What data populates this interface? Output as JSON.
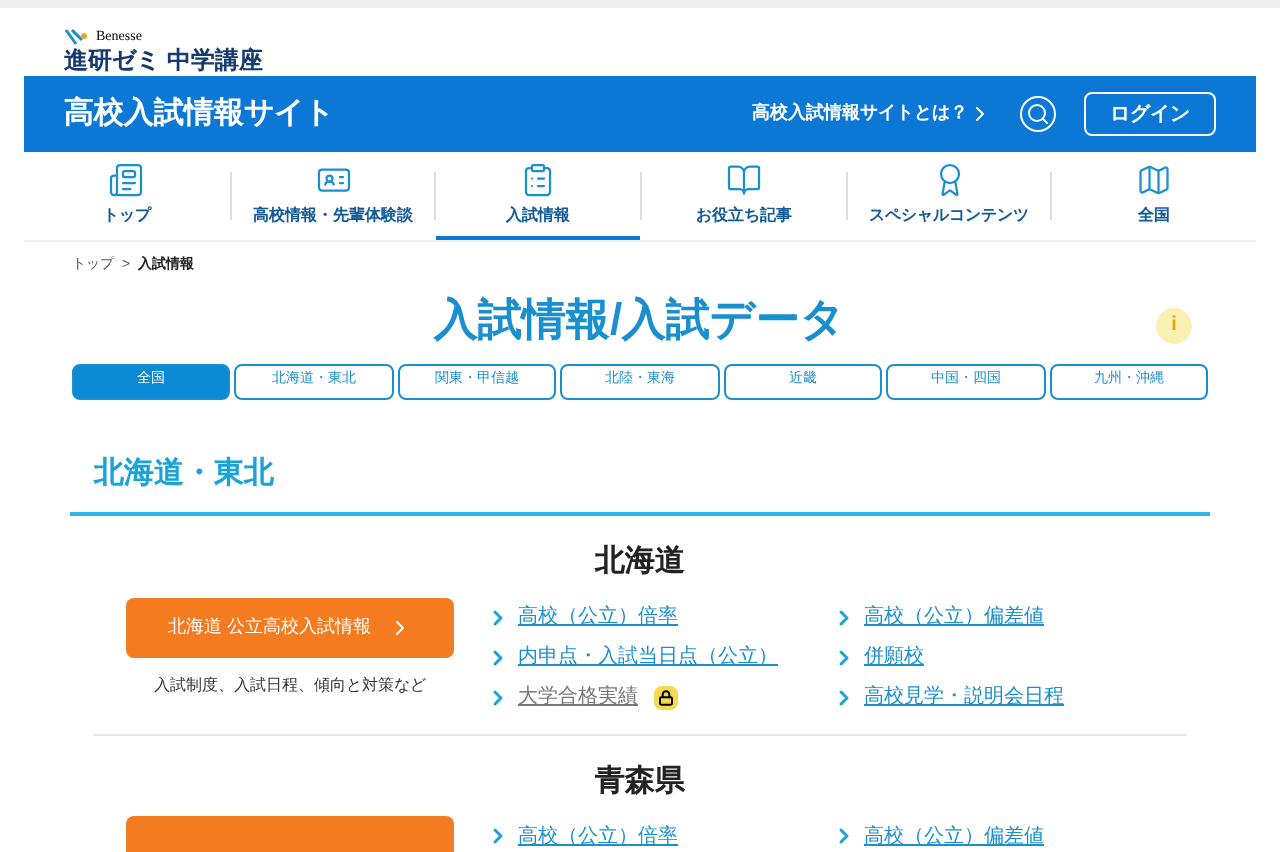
{
  "brand": {
    "company": "Benesse",
    "product": "進研ゼミ 中学講座"
  },
  "site_bar": {
    "title": "高校入試情報サイト",
    "about_link": "高校入試情報サイトとは？",
    "login": "ログイン"
  },
  "nav": [
    {
      "label": "トップ",
      "selected": false
    },
    {
      "label": "高校情報・先輩体験談",
      "selected": false
    },
    {
      "label": "入試情報",
      "selected": true
    },
    {
      "label": "お役立ち記事",
      "selected": false
    },
    {
      "label": "スペシャルコンテンツ",
      "selected": false
    },
    {
      "label": "全国",
      "selected": false
    }
  ],
  "breadcrumb": [
    {
      "label": "トップ",
      "current": false
    },
    {
      "label": "入試情報",
      "current": true
    }
  ],
  "breadcrumb_separator": ">",
  "page_title": "入試情報/入試データ",
  "info_badge": "i",
  "region_tabs": [
    {
      "label": "全国",
      "selected": true
    },
    {
      "label": "北海道・東北",
      "selected": false
    },
    {
      "label": "関東・甲信越",
      "selected": false
    },
    {
      "label": "北陸・東海",
      "selected": false
    },
    {
      "label": "近畿",
      "selected": false
    },
    {
      "label": "中国・四国",
      "selected": false
    },
    {
      "label": "九州・沖縄",
      "selected": false
    }
  ],
  "section_heading": "北海道・東北",
  "prefectures": [
    {
      "name": "北海道",
      "button": "北海道 公立高校入試情報",
      "description": "入試制度、入試日程、傾向と対策など",
      "links": [
        {
          "label": "高校（公立）倍率",
          "locked": false
        },
        {
          "label": "高校（公立）偏差値",
          "locked": false
        },
        {
          "label": "内申点・入試当日点（公立）",
          "locked": false
        },
        {
          "label": "併願校",
          "locked": false
        },
        {
          "label": "大学合格実績",
          "locked": true
        },
        {
          "label": "高校見学・説明会日程",
          "locked": false
        }
      ]
    },
    {
      "name": "青森県",
      "links": [
        {
          "label": "高校（公立）倍率",
          "locked": false
        },
        {
          "label": "高校（公立）偏差値",
          "locked": false
        }
      ]
    }
  ]
}
